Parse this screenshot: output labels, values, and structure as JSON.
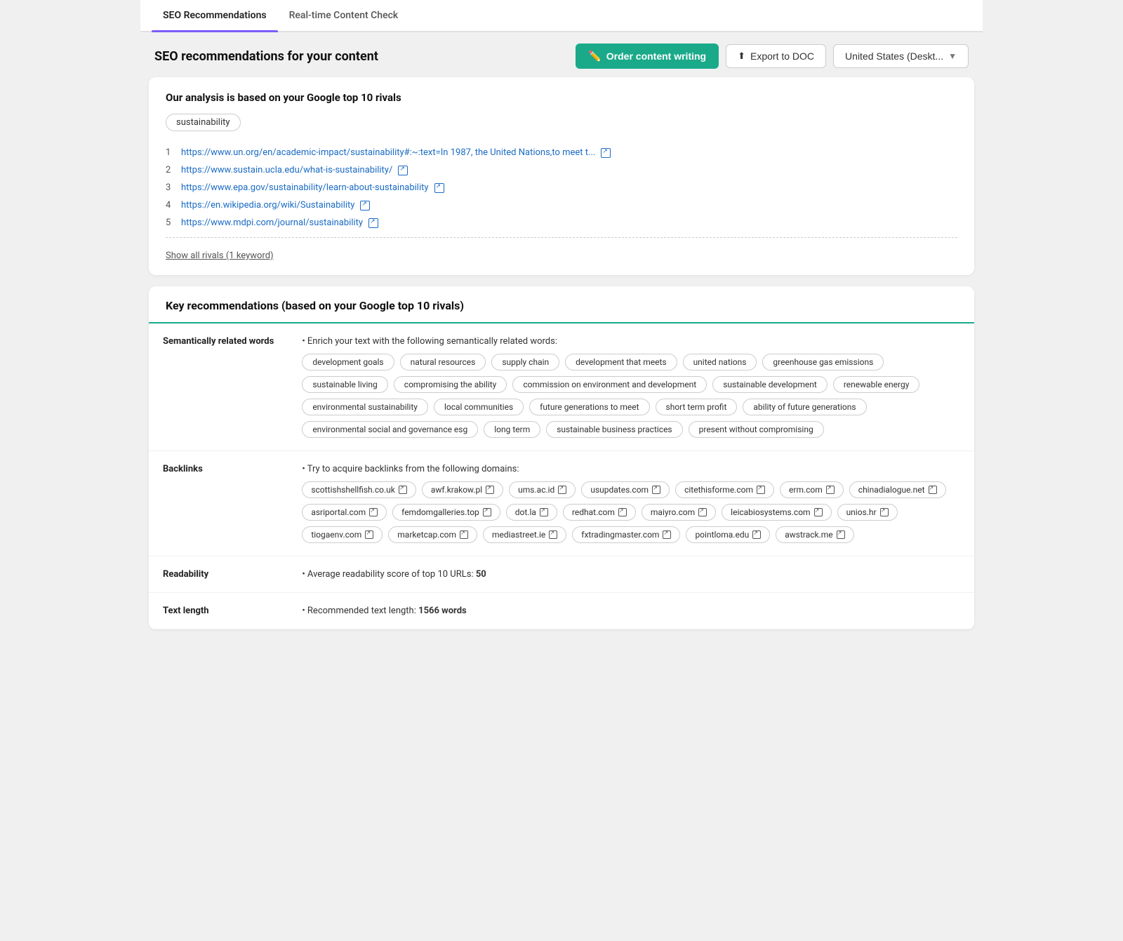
{
  "tabs": [
    {
      "id": "seo",
      "label": "SEO Recommendations",
      "active": true
    },
    {
      "id": "realtime",
      "label": "Real-time Content Check",
      "active": false
    }
  ],
  "header": {
    "title": "SEO recommendations for your content",
    "order_btn": "Order content writing",
    "export_btn": "Export to DOC",
    "region_btn": "United States (Deskt..."
  },
  "rivals_section": {
    "title": "Our analysis is based on your Google top 10 rivals",
    "keyword": "sustainability",
    "rivals": [
      {
        "num": 1,
        "url": "https://www.un.org/en/academic-impact/sustainability#:~:text=In 1987, the United Nations,to meet t..."
      },
      {
        "num": 2,
        "url": "https://www.sustain.ucla.edu/what-is-sustainability/"
      },
      {
        "num": 3,
        "url": "https://www.epa.gov/sustainability/learn-about-sustainability"
      },
      {
        "num": 4,
        "url": "https://en.wikipedia.org/wiki/Sustainability"
      },
      {
        "num": 5,
        "url": "https://www.mdpi.com/journal/sustainability"
      }
    ],
    "show_all_label": "Show all rivals (1 keyword)"
  },
  "key_recommendations": {
    "title": "Key recommendations (based on your Google top 10 rivals)",
    "sections": [
      {
        "id": "semantically-related",
        "label": "Semantically related words",
        "intro": "• Enrich your text with the following semantically related words:",
        "tags": [
          "development goals",
          "natural resources",
          "supply chain",
          "development that meets",
          "united nations",
          "greenhouse gas emissions",
          "sustainable living",
          "compromising the ability",
          "commission on environment and development",
          "sustainable development",
          "renewable energy",
          "environmental sustainability",
          "local communities",
          "future generations to meet",
          "short term profit",
          "ability of future generations",
          "environmental social and governance esg",
          "long term",
          "sustainable business practices",
          "present without compromising"
        ]
      },
      {
        "id": "backlinks",
        "label": "Backlinks",
        "intro": "• Try to acquire backlinks from the following domains:",
        "backlinks": [
          "scottishshellfish.co.uk",
          "awf.krakow.pl",
          "ums.ac.id",
          "usupdates.com",
          "citethisforme.com",
          "erm.com",
          "chinadialogue.net",
          "asriportal.com",
          "femdomgalleries.top",
          "dot.la",
          "redhat.com",
          "maiyro.com",
          "leicabiosystems.com",
          "unios.hr",
          "tiogaenv.com",
          "marketcap.com",
          "mediastreet.ie",
          "fxtradingmaster.com",
          "pointloma.edu",
          "awstrack.me"
        ]
      },
      {
        "id": "readability",
        "label": "Readability",
        "text_prefix": "• Average readability score of top 10 URLs: ",
        "score": "50"
      },
      {
        "id": "text-length",
        "label": "Text length",
        "text_prefix": "• Recommended text length: ",
        "value": "1566 words"
      }
    ]
  }
}
